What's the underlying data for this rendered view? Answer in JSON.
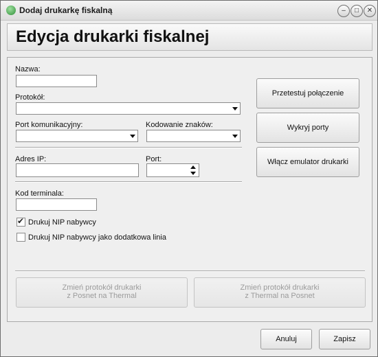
{
  "window": {
    "title": "Dodaj drukarkę fiskalną",
    "minimize": "–",
    "maximize": "□",
    "close": "✕"
  },
  "header": {
    "title": "Edycja drukarki fiskalnej"
  },
  "form": {
    "nazwa_label": "Nazwa:",
    "nazwa_value": "",
    "protokol_label": "Protokół:",
    "protokol_value": "",
    "port_label": "Port komunikacyjny:",
    "port_value": "",
    "kodowanie_label": "Kodowanie znaków:",
    "kodowanie_value": "",
    "adres_label": "Adres IP:",
    "adres_value": "",
    "tcp_port_label": "Port:",
    "tcp_port_value": "",
    "kod_label": "Kod terminala:",
    "kod_value": "",
    "nip_label": "Drukuj NIP nabywcy",
    "nip_checked": true,
    "nip_line_label": "Drukuj NIP nabywcy jako dodatkowa linia",
    "nip_line_checked": false
  },
  "side_buttons": {
    "test": "Przetestuj połączenie",
    "detect": "Wykryj porty",
    "emulator": "Włącz emulator drukarki"
  },
  "convert_buttons": {
    "to_thermal_line1": "Zmień protokół drukarki",
    "to_thermal_line2": "z Posnet na Thermal",
    "to_posnet_line1": "Zmień protokół drukarki",
    "to_posnet_line2": "z Thermal na Posnet"
  },
  "footer": {
    "cancel": "Anuluj",
    "save": "Zapisz"
  }
}
